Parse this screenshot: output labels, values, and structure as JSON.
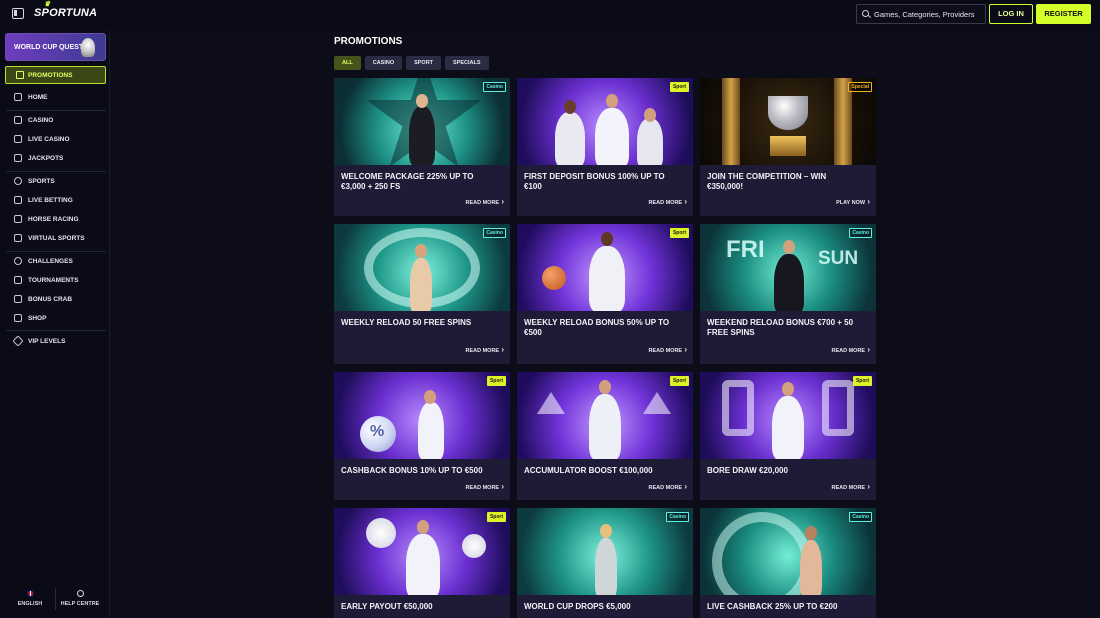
{
  "header": {
    "logo": "SPORTUNA",
    "search_placeholder": "Games, Categories, Providers",
    "login_label": "LOG IN",
    "register_label": "REGISTER"
  },
  "sidebar": {
    "quest_label": "WORLD CUP QUEST",
    "active_item": "PROMOTIONS",
    "items": [
      "HOME",
      "CASINO",
      "LIVE CASINO",
      "JACKPOTS",
      "SPORTS",
      "LIVE BETTING",
      "HORSE RACING",
      "VIRTUAL SPORTS",
      "CHALLENGES",
      "TOURNAMENTS",
      "BONUS CRAB",
      "SHOP",
      "VIP LEVELS"
    ],
    "footer": {
      "language": "ENGLISH",
      "help": "HELP CENTRE"
    }
  },
  "main": {
    "title": "PROMOTIONS",
    "filters": [
      "ALL",
      "CASINO",
      "SPORT",
      "SPECIALS"
    ],
    "active_filter": "ALL",
    "cards": [
      {
        "tag": "Casino",
        "title": "WELCOME PACKAGE 225% UP TO €3,000 + 250 FS",
        "cta": "READ MORE"
      },
      {
        "tag": "Sport",
        "title": "FIRST DEPOSIT BONUS 100% UP TO €100",
        "cta": "READ MORE"
      },
      {
        "tag": "Special",
        "title": "JOIN THE COMPETITION – WIN €350,000!",
        "cta": "PLAY NOW"
      },
      {
        "tag": "Casino",
        "title": "WEEKLY RELOAD 50 FREE SPINS",
        "cta": "READ MORE"
      },
      {
        "tag": "Sport",
        "title": "WEEKLY RELOAD BONUS 50% UP TO €500",
        "cta": "READ MORE"
      },
      {
        "tag": "Casino",
        "title": "WEEKEND RELOAD BONUS €700 + 50 FREE SPINS",
        "cta": "READ MORE"
      },
      {
        "tag": "Sport",
        "title": "CASHBACK BONUS 10% UP TO €500",
        "cta": "READ MORE"
      },
      {
        "tag": "Sport",
        "title": "ACCUMULATOR BOOST €100,000",
        "cta": "READ MORE"
      },
      {
        "tag": "Sport",
        "title": "BORE DRAW €20,000",
        "cta": "READ MORE"
      },
      {
        "tag": "Sport",
        "title": "EARLY PAYOUT €50,000",
        "cta": ""
      },
      {
        "tag": "Casino",
        "title": "WORLD CUP DROPS €5,000",
        "cta": ""
      },
      {
        "tag": "Casino",
        "title": "LIVE CASHBACK 25% UP TO €200",
        "cta": ""
      }
    ],
    "artwork_text": {
      "fri": "FRI",
      "sun": "SUN",
      "percent": "%"
    }
  },
  "colors": {
    "accent": "#d5ff2b",
    "background": "#0d0d1a",
    "card": "#1d1b35"
  }
}
